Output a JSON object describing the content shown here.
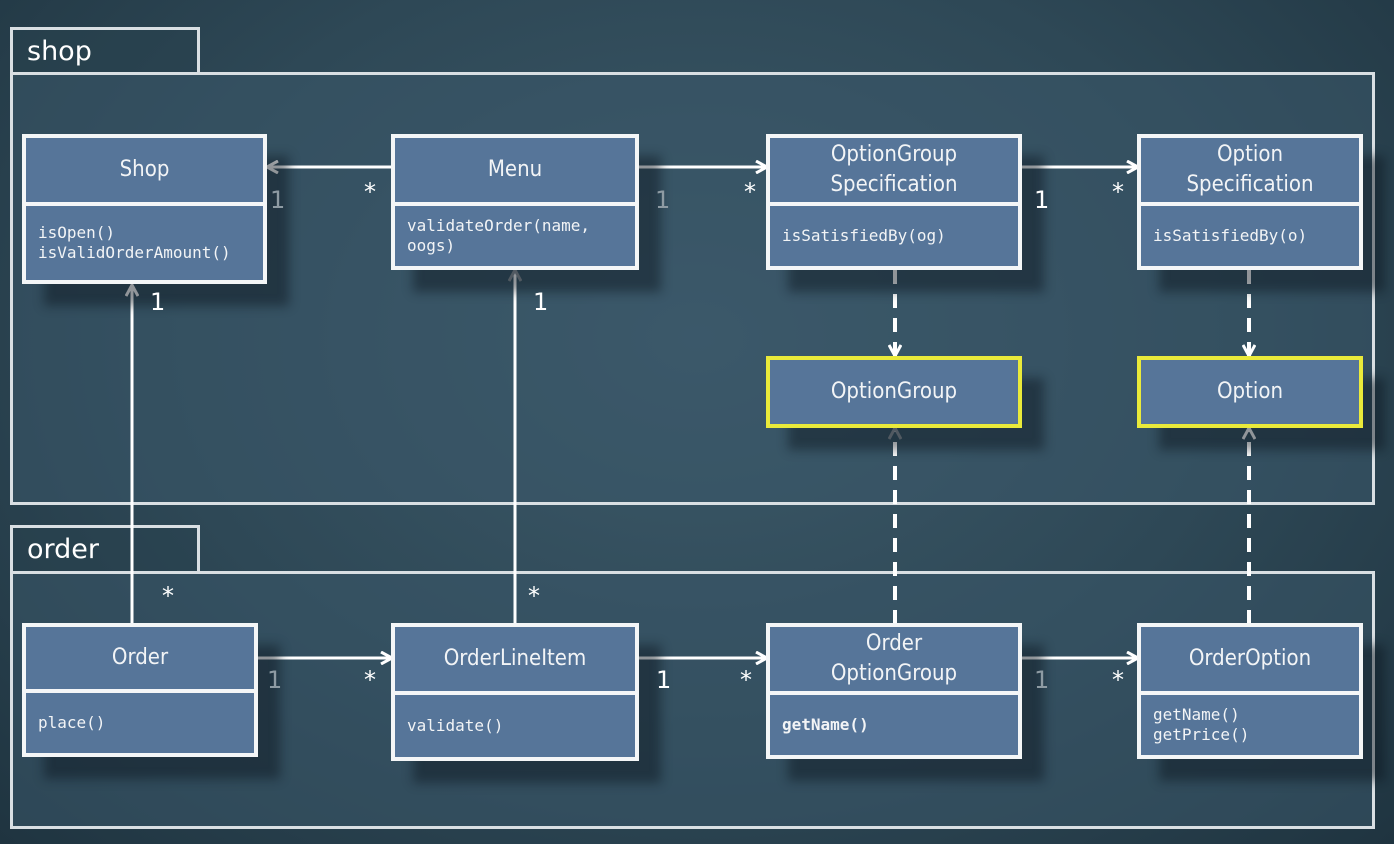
{
  "packages": [
    {
      "id": "shop",
      "label": "shop"
    },
    {
      "id": "order",
      "label": "order"
    }
  ],
  "classes": {
    "shop": {
      "name": "Shop",
      "ops": [
        "isOpen()",
        "isValidOrderAmount()"
      ]
    },
    "menu": {
      "name": "Menu",
      "ops": [
        "validateOrder(name,",
        "oogs)"
      ]
    },
    "optionGroupSpec": {
      "name": "OptionGroup\nSpecification",
      "ops": [
        "isSatisfiedBy(og)"
      ]
    },
    "optionSpec": {
      "name": "Option\nSpecification",
      "ops": [
        "isSatisfiedBy(o)"
      ]
    },
    "optionGroup": {
      "name": "OptionGroup",
      "highlighted": true
    },
    "option": {
      "name": "Option",
      "highlighted": true
    },
    "order": {
      "name": "Order",
      "ops": [
        "place()"
      ]
    },
    "orderLineItem": {
      "name": "OrderLineItem",
      "ops": [
        "validate()"
      ]
    },
    "orderOptionGroup": {
      "name": "Order\nOptionGroup",
      "ops": [
        "getName()"
      ]
    },
    "orderOption": {
      "name": "OrderOption",
      "ops": [
        "getName()",
        "getPrice()"
      ]
    }
  },
  "multiplicities": {
    "menu_shop_one": "1",
    "menu_shop_many": "*",
    "menu_ogs_one": "1",
    "menu_ogs_many": "*",
    "ogs_os_one": "1",
    "ogs_os_many": "*",
    "order_shop_one": "1",
    "order_shop_many": "*",
    "oli_menu_one": "1",
    "oli_menu_many": "*",
    "order_oli_one": "1",
    "order_oli_many": "*",
    "oli_oog_one": "1",
    "oli_oog_many": "*",
    "oog_oo_one": "1",
    "oog_oo_many": "*"
  },
  "colors": {
    "class_fill": "#567599",
    "class_border": "#f4f6f7",
    "highlight_border": "#eaea3a",
    "line": "#ffffff"
  }
}
